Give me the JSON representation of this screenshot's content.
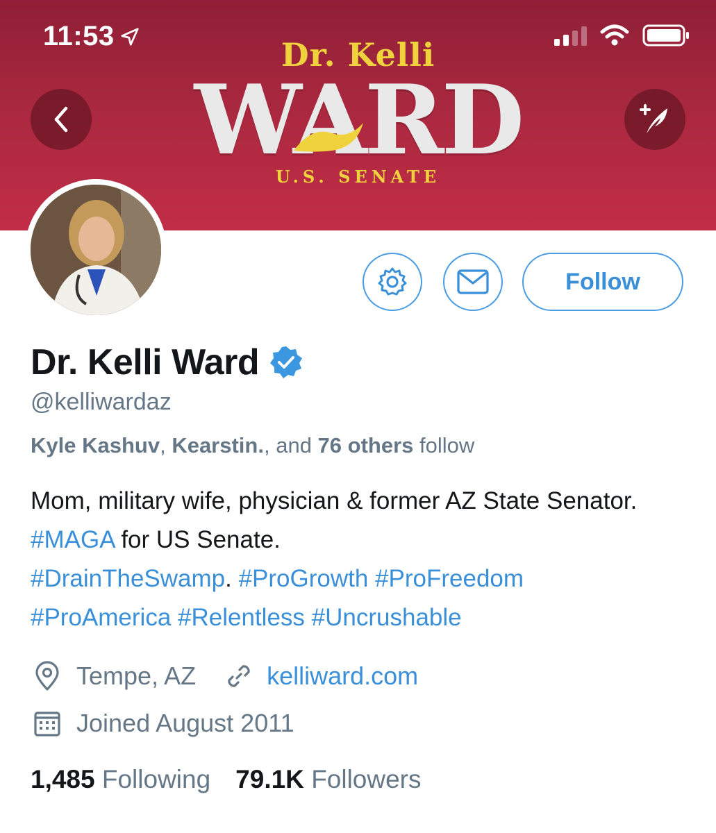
{
  "status_bar": {
    "time": "11:53"
  },
  "banner": {
    "top_line": "Dr. Kelli",
    "main_word": "WARD",
    "sub_line": "U.S. SENATE"
  },
  "profile": {
    "name": "Dr. Kelli Ward",
    "handle": "@kelliwardaz",
    "verified": true,
    "followers_you_know": {
      "name1": "Kyle Kashuv",
      "sep1": ", ",
      "name2": "Kearstin.",
      "sep2": ", and ",
      "others": "76 others",
      "suffix": " follow"
    },
    "bio": {
      "t1": "Mom, military wife, physician & former AZ State Senator. ",
      "h1": "#MAGA",
      "t2": " for US Senate. ",
      "h2": "#DrainTheSwamp",
      "t3": ". ",
      "h3": "#ProGrowth",
      "h4": "#ProFreedom",
      "h5": "#ProAmerica",
      "h6": "#Relentless",
      "h7": "#Uncrushable"
    },
    "location": "Tempe, AZ",
    "website": "kelliward.com",
    "joined": "Joined August 2011",
    "following_count": "1,485",
    "following_label": "Following",
    "followers_count": "79.1K",
    "followers_label": "Followers"
  },
  "actions": {
    "follow_label": "Follow"
  },
  "colors": {
    "banner": "#a8283f",
    "accent": "#3a8fd9",
    "gold": "#f0d23c"
  }
}
